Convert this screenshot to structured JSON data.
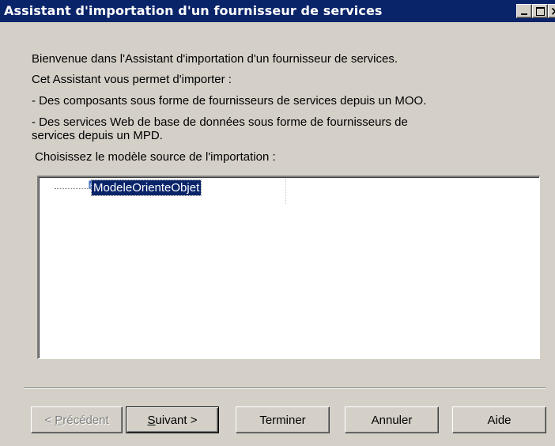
{
  "window": {
    "title": "Assistant d'importation d'un fournisseur de services",
    "controls": {
      "minimize": "_",
      "maximize": "□",
      "close": "×"
    }
  },
  "intro": {
    "line1": "Bienvenue dans l'Assistant d'importation d'un fournisseur de services.",
    "line2": "Cet Assistant vous permet d'importer :",
    "line3": "- Des composants sous forme de fournisseurs de services depuis un MOO.",
    "line4": "- Des services Web de base de données sous forme de fournisseurs de",
    "line5": "services depuis un MPD."
  },
  "source": {
    "prompt": "Choisissez le modèle source de l'importation :",
    "tree": [
      {
        "label": "ModeleOrienteObjet",
        "icon": "model-gear-icon",
        "selected": true
      }
    ]
  },
  "buttons": {
    "previous": {
      "prefix": "< ",
      "mnemonic": "P",
      "rest": "récédent",
      "enabled": false
    },
    "next": {
      "mnemonic": "S",
      "rest": "uivant >",
      "enabled": true,
      "default": true
    },
    "finish": {
      "label": "Terminer"
    },
    "cancel": {
      "label": "Annuler"
    },
    "help": {
      "label": "Aide"
    }
  },
  "colors": {
    "titlebar": "#0a246a",
    "face": "#d4d0c8",
    "selection": "#0a246a"
  }
}
